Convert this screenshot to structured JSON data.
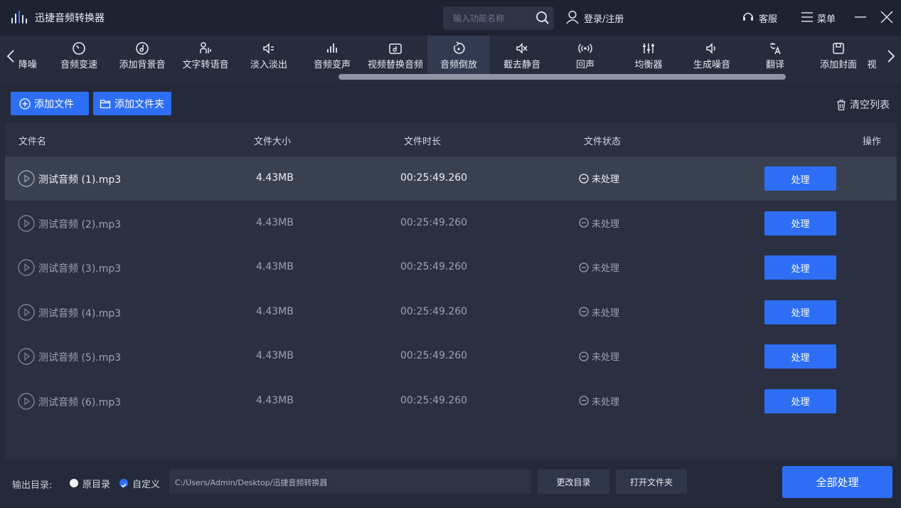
{
  "app": {
    "title": "迅捷音频转换器"
  },
  "header": {
    "search_placeholder": "输入功能名称",
    "login_label": "登录/注册",
    "service_label": "客服",
    "menu_label": "菜单"
  },
  "tools": [
    {
      "label": "降噪",
      "icon": "noise-icon",
      "partial": true
    },
    {
      "label": "音频变速",
      "icon": "speed-icon"
    },
    {
      "label": "添加背景音",
      "icon": "music-note-icon"
    },
    {
      "label": "文字转语音",
      "icon": "text-speech-icon"
    },
    {
      "label": "淡入淡出",
      "icon": "fade-icon"
    },
    {
      "label": "音频变声",
      "icon": "voice-change-icon"
    },
    {
      "label": "视频替换音频",
      "icon": "video-audio-icon"
    },
    {
      "label": "音频倒放",
      "icon": "reverse-icon",
      "active": true
    },
    {
      "label": "截去静音",
      "icon": "mute-icon"
    },
    {
      "label": "回声",
      "icon": "echo-icon"
    },
    {
      "label": "均衡器",
      "icon": "equalizer-icon"
    },
    {
      "label": "生成噪音",
      "icon": "noise-gen-icon"
    },
    {
      "label": "翻译",
      "icon": "translate-icon"
    },
    {
      "label": "添加封面",
      "icon": "cover-icon"
    },
    {
      "label": "视",
      "icon": "",
      "partial": true
    }
  ],
  "actions": {
    "add_file": "添加文件",
    "add_folder": "添加文件夹",
    "clear_list": "清空列表"
  },
  "table": {
    "columns": {
      "name": "文件名",
      "size": "文件大小",
      "duration": "文件时长",
      "status": "文件状态",
      "action": "操作"
    },
    "rows": [
      {
        "name": "测试音频 (1).mp3",
        "size": "4.43MB",
        "duration": "00:25:49.260",
        "status": "未处理",
        "action": "处理"
      },
      {
        "name": "测试音频 (2).mp3",
        "size": "4.43MB",
        "duration": "00:25:49.260",
        "status": "未处理",
        "action": "处理"
      },
      {
        "name": "测试音频 (3).mp3",
        "size": "4.43MB",
        "duration": "00:25:49.260",
        "status": "未处理",
        "action": "处理"
      },
      {
        "name": "测试音频 (4).mp3",
        "size": "4.43MB",
        "duration": "00:25:49.260",
        "status": "未处理",
        "action": "处理"
      },
      {
        "name": "测试音频 (5).mp3",
        "size": "4.43MB",
        "duration": "00:25:49.260",
        "status": "未处理",
        "action": "处理"
      },
      {
        "name": "测试音频 (6).mp3",
        "size": "4.43MB",
        "duration": "00:25:49.260",
        "status": "未处理",
        "action": "处理"
      }
    ]
  },
  "footer": {
    "output_label": "输出目录:",
    "option_original": "原目录",
    "option_custom": "自定义",
    "selected_option": "自定义",
    "path": "C:/Users/Admin/Desktop/迅捷音频转换器",
    "change_dir": "更改目录",
    "open_folder": "打开文件夹",
    "process_all": "全部处理"
  },
  "colors": {
    "accent": "#2d6ef5",
    "background": "#252a3a",
    "titlebar": "#1e2231"
  }
}
